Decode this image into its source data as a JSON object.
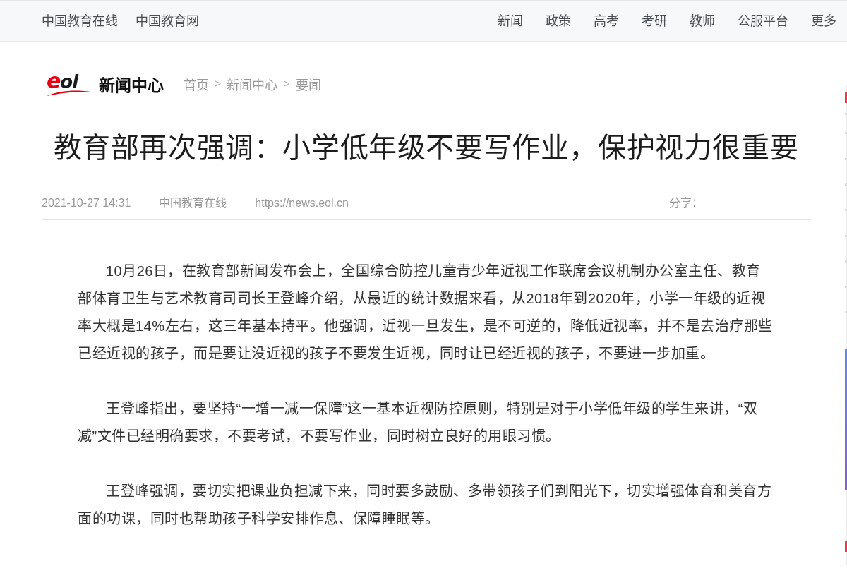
{
  "top_nav": {
    "left_links": [
      "中国教育在线",
      "中国教育网"
    ],
    "right_links": [
      "新闻",
      "政策",
      "高考",
      "考研",
      "教师",
      "公服平台",
      "更多"
    ]
  },
  "header": {
    "logo": "eol",
    "section_title": "新闻中心",
    "breadcrumb": [
      {
        "kind": "link",
        "label": "首页"
      },
      {
        "kind": "separator",
        "label": ">"
      },
      {
        "kind": "link",
        "label": "新闻中心"
      },
      {
        "kind": "separator",
        "label": ">"
      },
      {
        "kind": "link",
        "label": "要闻"
      }
    ]
  },
  "article": {
    "title": "教育部再次强调：小学低年级不要写作业，保护视力很重要",
    "meta": {
      "date": "2021-10-27 14:31",
      "source": "中国教育在线",
      "url": "https://news.eol.cn",
      "share_label": "分享："
    },
    "paragraphs": [
      "10月26日，在教育部新闻发布会上，全国综合防控儿童青少年近视工作联席会议机制办公室主任、教育部体育卫生与艺术教育司司长王登峰介绍，从最近的统计数据来看，从2018年到2020年，小学一年级的近视率大概是14%左右，这三年基本持平。他强调，近视一旦发生，是不可逆的，降低近视率，并不是去治疗那些已经近视的孩子，而是要让没近视的孩子不要发生近视，同时让已经近视的孩子，不要进一步加重。",
      "王登峰指出，要坚持“一增一减一保障”这一基本近视防控原则，特别是对于小学低年级的学生来讲，“双减”文件已经明确要求，不要考试，不要写作业，同时树立良好的用眼习惯。",
      "王登峰强调，要切实把课业负担减下来，同时要多鼓励、多带领孩子们到阳光下，切实增强体育和美育方面的功课，同时也帮助孩子科学安排作息、保障睡眠等。"
    ]
  }
}
